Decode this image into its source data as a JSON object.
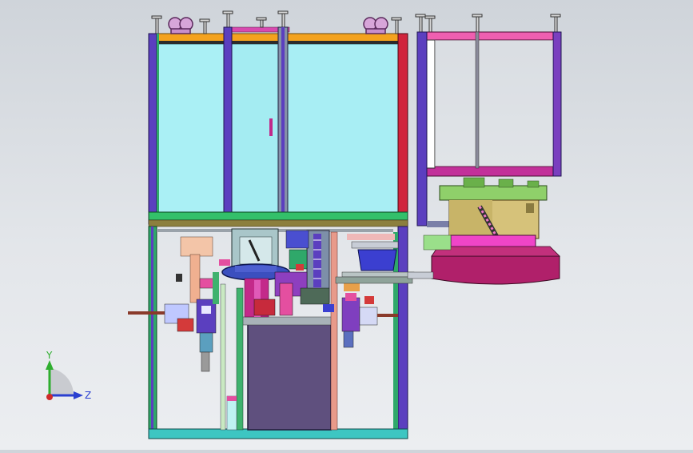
{
  "viewport": {
    "background_top": "#cfd4da",
    "background_bottom": "#eceef1"
  },
  "triad": {
    "y_label": "Y",
    "z_label": "Z",
    "y_color": "#2fae2f",
    "z_color": "#2a3fd0",
    "x_color": "#d02a2a"
  },
  "model": {
    "colors": {
      "frame_purple": "#5b3fbf",
      "frame_green": "#2fa86a",
      "glass": "#a8eef4",
      "top_orange": "#f4a21e",
      "hopper_pink": "#e44fa0",
      "bowl_magenta": "#b0206a",
      "bowl_gold": "#d6c27a",
      "cabinet_dark": "#5f507e",
      "red_post": "#d0243c"
    }
  }
}
